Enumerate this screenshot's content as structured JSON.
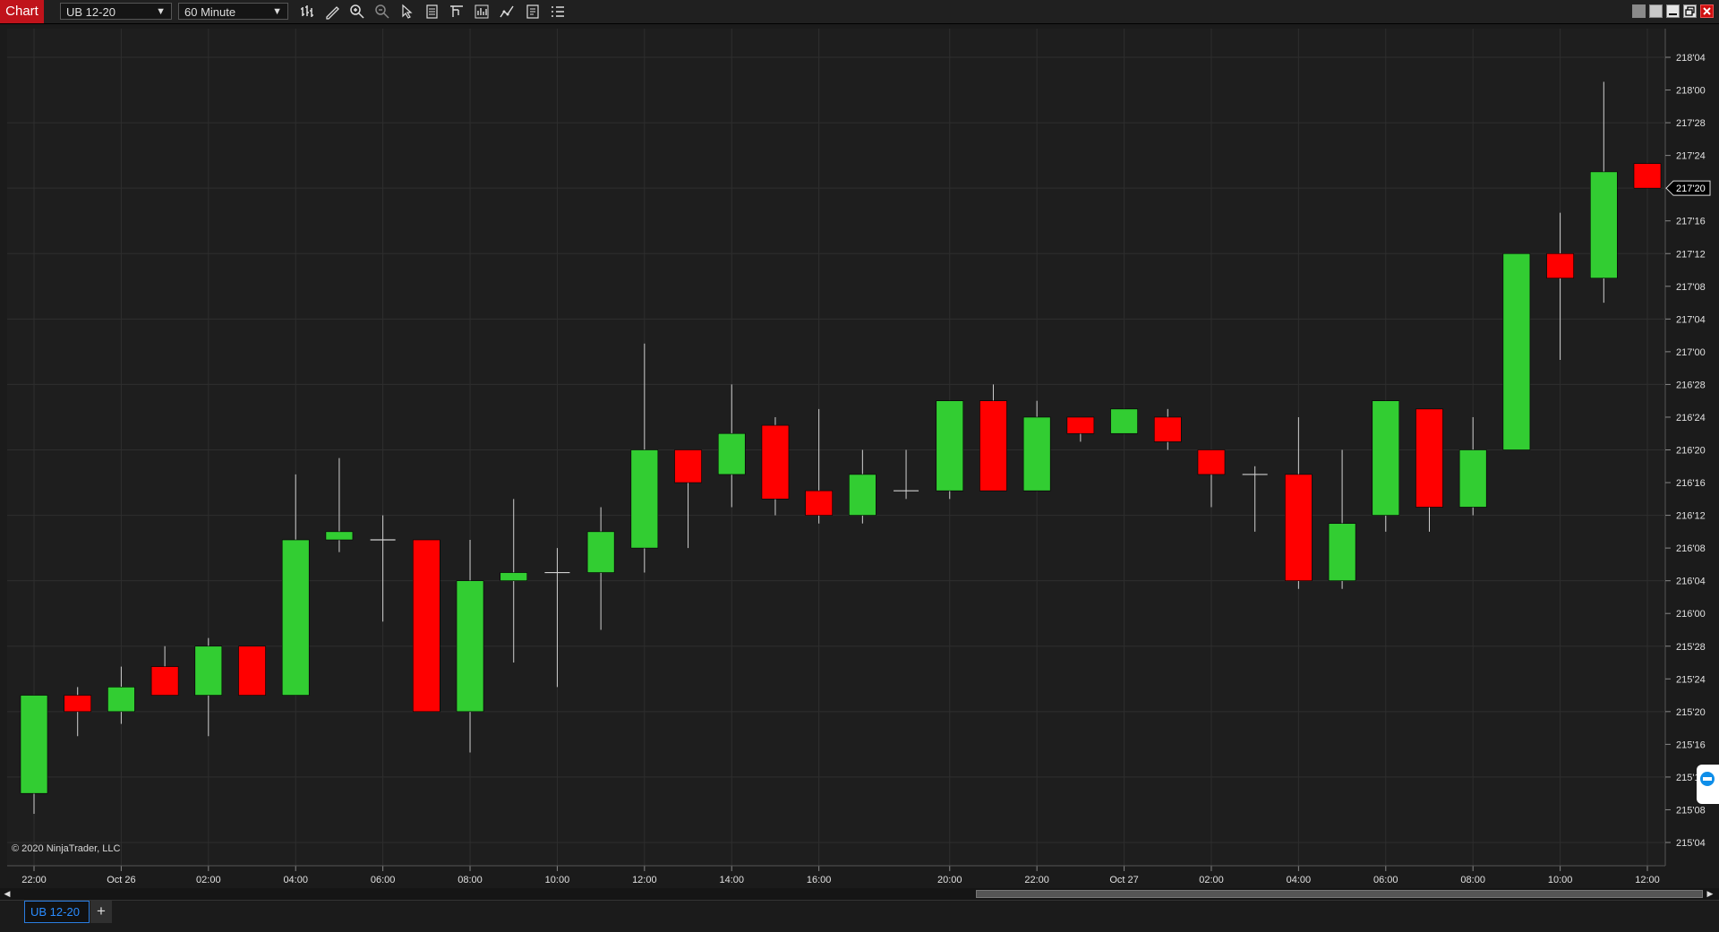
{
  "toolbar": {
    "chart_tab_label": "Chart",
    "instrument": "UB 12-20",
    "interval": "60 Minute",
    "icons": [
      "bars-type-icon",
      "drawing-tools-icon",
      "zoom-in-icon",
      "zoom-out-icon",
      "pointer-icon",
      "data-box-icon",
      "templates-icon",
      "strategies-icon",
      "indicators-icon",
      "properties-icon",
      "chart-trader-icon"
    ],
    "window_buttons": [
      "tile-icon",
      "grid-icon",
      "minimize-icon",
      "maximize-icon",
      "close-icon"
    ]
  },
  "copyright": "© 2020 NinjaTrader, LLC",
  "bottom": {
    "instrument_tab": "UB 12-20",
    "add_tab": "+"
  },
  "colors": {
    "background": "#1e1e1e",
    "grid": "#2e2e2e",
    "up": "#32cd32",
    "down": "#ff0000",
    "wick": "#d0d0d0",
    "text": "#e0e0e0"
  },
  "chart_data": {
    "type": "candlestick",
    "instrument": "UB 12-20",
    "interval": "60 Minute",
    "price_axis_ticks": [
      "218'04",
      "218'00",
      "217'28",
      "217'24",
      "217'20",
      "217'16",
      "217'12",
      "217'08",
      "217'04",
      "217'00",
      "216'28",
      "216'24",
      "216'20",
      "216'16",
      "216'12",
      "216'08",
      "216'04",
      "216'00",
      "215'28",
      "215'24",
      "215'20",
      "215'16",
      "215'12",
      "215'08",
      "215'04"
    ],
    "time_axis_labels": [
      "22:00",
      "Oct 26",
      "02:00",
      "04:00",
      "06:00",
      "08:00",
      "10:00",
      "12:00",
      "14:00",
      "16:00",
      "20:00",
      "22:00",
      "Oct 27",
      "02:00",
      "04:00",
      "06:00",
      "08:00",
      "10:00",
      "12:00"
    ],
    "ylim_32nds": [
      6974,
      7014
    ],
    "price_unit": "32nds (218'04 = 218 + 4/32)",
    "current_price": "217'20",
    "candles": [
      {
        "time": "22:00",
        "open": 215.3125,
        "high": 215.4688,
        "low": 215.2344,
        "close": 215.6875
      },
      {
        "time": "23:00",
        "open": 215.6875,
        "high": 215.7188,
        "low": 215.5312,
        "close": 215.625
      },
      {
        "time": "Oct 26",
        "open": 215.625,
        "high": 215.7969,
        "low": 215.5781,
        "close": 215.7188
      },
      {
        "time": "01:00",
        "open": 215.7969,
        "high": 215.875,
        "low": 215.6875,
        "close": 215.6875
      },
      {
        "time": "02:00",
        "open": 215.6875,
        "high": 215.9062,
        "low": 215.5312,
        "close": 215.875
      },
      {
        "time": "03:00",
        "open": 215.875,
        "high": 215.875,
        "low": 215.6875,
        "close": 215.6875
      },
      {
        "time": "04:00",
        "open": 215.6875,
        "high": 216.5312,
        "low": 215.6875,
        "close": 216.2812
      },
      {
        "time": "05:00",
        "open": 216.2812,
        "high": 216.5938,
        "low": 216.2344,
        "close": 216.3125
      },
      {
        "time": "06:00",
        "open": 216.2812,
        "high": 216.375,
        "low": 215.9688,
        "close": 216.2812
      },
      {
        "time": "07:00",
        "open": 216.2812,
        "high": 216.2812,
        "low": 215.625,
        "close": 215.625
      },
      {
        "time": "08:00",
        "open": 215.625,
        "high": 216.2812,
        "low": 215.4688,
        "close": 216.125
      },
      {
        "time": "09:00",
        "open": 216.125,
        "high": 216.4375,
        "low": 215.8125,
        "close": 216.1562
      },
      {
        "time": "10:00",
        "open": 216.1562,
        "high": 216.25,
        "low": 215.7188,
        "close": 216.1562
      },
      {
        "time": "11:00",
        "open": 216.1562,
        "high": 216.4062,
        "low": 215.9375,
        "close": 216.3125
      },
      {
        "time": "12:00",
        "open": 216.25,
        "high": 217.0312,
        "low": 216.1562,
        "close": 216.625
      },
      {
        "time": "13:00",
        "open": 216.625,
        "high": 216.625,
        "low": 216.25,
        "close": 216.5
      },
      {
        "time": "14:00",
        "open": 216.5312,
        "high": 216.875,
        "low": 216.4062,
        "close": 216.6875
      },
      {
        "time": "15:00",
        "open": 216.7188,
        "high": 216.75,
        "low": 216.375,
        "close": 216.4375
      },
      {
        "time": "16:00",
        "open": 216.4688,
        "high": 216.7812,
        "low": 216.3438,
        "close": 216.375
      },
      {
        "time": "17:00",
        "open": 216.375,
        "high": 216.625,
        "low": 216.3438,
        "close": 216.5312
      },
      {
        "time": "18:00",
        "open": 216.4688,
        "high": 216.625,
        "low": 216.4375,
        "close": 216.4688
      },
      {
        "time": "20:00",
        "open": 216.4688,
        "high": 216.8125,
        "low": 216.4375,
        "close": 216.8125
      },
      {
        "time": "21:00",
        "open": 216.8125,
        "high": 216.875,
        "low": 216.4688,
        "close": 216.4688
      },
      {
        "time": "22:00",
        "open": 216.4688,
        "high": 216.8125,
        "low": 216.4688,
        "close": 216.75
      },
      {
        "time": "23:00",
        "open": 216.75,
        "high": 216.75,
        "low": 216.6562,
        "close": 216.6875
      },
      {
        "time": "Oct 27",
        "open": 216.6875,
        "high": 216.7812,
        "low": 216.6875,
        "close": 216.7812
      },
      {
        "time": "01:00",
        "open": 216.75,
        "high": 216.7812,
        "low": 216.625,
        "close": 216.6562
      },
      {
        "time": "02:00",
        "open": 216.625,
        "high": 216.625,
        "low": 216.4062,
        "close": 216.5312
      },
      {
        "time": "03:00",
        "open": 216.5312,
        "high": 216.5625,
        "low": 216.3125,
        "close": 216.5312
      },
      {
        "time": "04:00",
        "open": 216.5312,
        "high": 216.75,
        "low": 216.0938,
        "close": 216.125
      },
      {
        "time": "05:00",
        "open": 216.125,
        "high": 216.625,
        "low": 216.0938,
        "close": 216.3438
      },
      {
        "time": "06:00",
        "open": 216.375,
        "high": 216.8125,
        "low": 216.3125,
        "close": 216.8125
      },
      {
        "time": "07:00",
        "open": 216.7812,
        "high": 216.7812,
        "low": 216.3125,
        "close": 216.4062
      },
      {
        "time": "08:00",
        "open": 216.4062,
        "high": 216.75,
        "low": 216.375,
        "close": 216.625
      },
      {
        "time": "09:00",
        "open": 216.625,
        "high": 217.3125,
        "low": 216.625,
        "close": 217.375
      },
      {
        "time": "10:00",
        "open": 217.375,
        "high": 217.5312,
        "low": 216.9688,
        "close": 217.2812
      },
      {
        "time": "11:00",
        "open": 217.2812,
        "high": 218.0312,
        "low": 217.1875,
        "close": 217.6875
      },
      {
        "time": "12:00",
        "open": 217.7188,
        "high": 217.7188,
        "low": 217.625,
        "close": 217.625
      }
    ]
  }
}
